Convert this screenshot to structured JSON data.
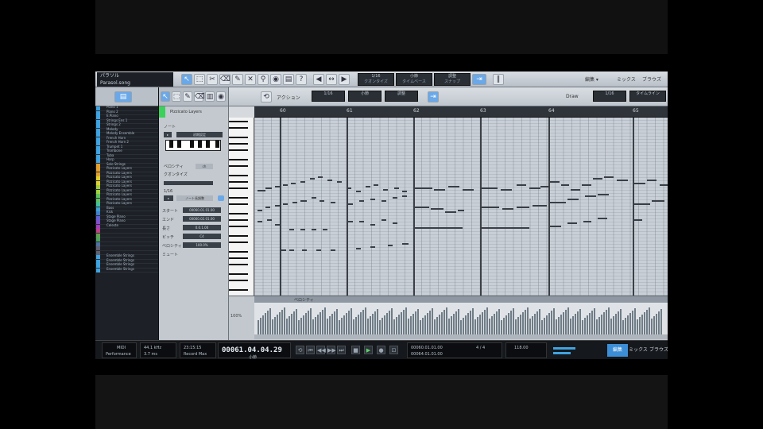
{
  "toolbar": {
    "song_title": "パラソル",
    "song_sub": "Parasol.song",
    "fields": [
      {
        "label": "1/16",
        "value": "クオンタイズ"
      },
      {
        "label": "小節",
        "value": "タイムベース"
      },
      {
        "label": "調整",
        "value": "スナップ"
      }
    ],
    "right": [
      "編集 ▾",
      "ミックス",
      "ブラウズ"
    ]
  },
  "tracks": {
    "items": [
      {
        "name": "Piano 1",
        "color": "#3fa3e0"
      },
      {
        "name": "Piano 2",
        "color": "#3fa3e0"
      },
      {
        "name": "E.Piano",
        "color": "#3fa3e0"
      },
      {
        "name": "Strings Ens 1",
        "color": "#3fa3e0"
      },
      {
        "name": "Strings 2",
        "color": "#3fa3e0"
      },
      {
        "name": "Melody",
        "color": "#3fa3e0"
      },
      {
        "name": "Melody Ensemble",
        "color": "#3fa3e0"
      },
      {
        "name": "French Horn",
        "color": "#3fa3e0"
      },
      {
        "name": "French Horn 2",
        "color": "#3fa3e0"
      },
      {
        "name": "Trumpet 1",
        "color": "#3fa3e0"
      },
      {
        "name": "Trombone",
        "color": "#3fa3e0"
      },
      {
        "name": "Tuba",
        "color": "#3fa3e0"
      },
      {
        "name": "Harp",
        "color": "#3fa3e0"
      },
      {
        "name": "Solo Strings",
        "color": "#e0a030"
      },
      {
        "name": "Pizzicato Layers",
        "color": "#e0a030"
      },
      {
        "name": "Pizzicato Layers",
        "color": "#e0a030"
      },
      {
        "name": "Pizzicato Layers",
        "color": "#e0d030"
      },
      {
        "name": "Pizzicato Layers",
        "color": "#e0d030"
      },
      {
        "name": "Pizzicato Layers",
        "color": "#a0d040"
      },
      {
        "name": "Pizzicato Layers",
        "color": "#a0d040"
      },
      {
        "name": "Pizzicato Layers",
        "color": "#60c060"
      },
      {
        "name": "Pizzicato Layers",
        "color": "#60c060"
      },
      {
        "name": "Pizzicato Layers",
        "color": "#40c0a0"
      },
      {
        "name": "Bass",
        "color": "#40a0d0"
      },
      {
        "name": "Kick",
        "color": "#4080d0"
      },
      {
        "name": "Stage Piano",
        "color": "#6060d0"
      },
      {
        "name": "Stage Piano",
        "color": "#8050c8"
      },
      {
        "name": "Celeste",
        "color": "#a040c0"
      },
      {
        "name": "",
        "color": "#c04080"
      },
      {
        "name": "",
        "color": "#60a050"
      },
      {
        "name": "",
        "color": "#50a060"
      },
      {
        "name": "",
        "color": "#5070a0"
      },
      {
        "name": "",
        "color": "#606070"
      },
      {
        "name": "",
        "color": "#606070"
      },
      {
        "name": "Ensemble Strings",
        "color": "#3fa3e0"
      },
      {
        "name": "Ensemble Strings",
        "color": "#3fa3e0"
      },
      {
        "name": "Ensemble Strings",
        "color": "#3fa3e0"
      },
      {
        "name": "Ensemble Strings",
        "color": "#3fa3e0"
      }
    ]
  },
  "inspector": {
    "instrument": "Pizzicato Layers",
    "section_note": "ノート",
    "preset": "初期設定",
    "velocity_label": "ベロシティ",
    "channel_label": "ch",
    "quantize": "1/16",
    "q_label": "クオンタイズ",
    "play_mode": "ノート長調整",
    "rows": [
      {
        "label": "スタート",
        "value": "00060.01.01.00"
      },
      {
        "label": "エンド",
        "value": "00060.02.01.00"
      },
      {
        "label": "長さ",
        "value": "0.0.1.00"
      },
      {
        "label": "ピッチ",
        "value": "C4"
      },
      {
        "label": "ベロシティ",
        "value": "100.0%"
      },
      {
        "label": "ミュート",
        "value": ""
      }
    ]
  },
  "editor": {
    "toolbar_label": "アクション",
    "tool_fields": [
      "1/16",
      "小節",
      "調整"
    ],
    "zoom_label": "Draw",
    "right_fields": [
      "1/16",
      "タイムライン"
    ],
    "ruler": [
      "60",
      "61",
      "62",
      "63",
      "64",
      "65"
    ],
    "velocity_tab": "ベロシティ",
    "velocity_axis": "100%"
  },
  "transport": {
    "midi_label": "MIDI",
    "perf_label": "Performance",
    "sample_rate": "44.1 kHz",
    "latency": "3.7 ms",
    "record": "23:15:15",
    "record_label": "Record Max",
    "time": "00061.04.04.29",
    "time_unit": "小節",
    "loop_start": "00060.01.01.00",
    "loop_end": "00064.01.01.00",
    "tempo": "118.00",
    "sig": "4 / 4",
    "tabs": [
      "編集",
      "ミックス",
      "ブラウズ"
    ]
  }
}
